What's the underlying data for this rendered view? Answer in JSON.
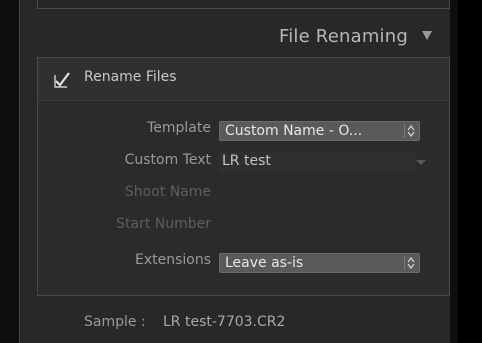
{
  "panel": {
    "title": "File Renaming",
    "collapse_icon": "triangle-down-icon"
  },
  "rename": {
    "checked": true,
    "label": "Rename Files"
  },
  "template": {
    "label": "Template",
    "value": "Custom Name - O..."
  },
  "custom_text": {
    "label": "Custom Text",
    "value": "LR test"
  },
  "shoot_name": {
    "label": "Shoot Name"
  },
  "start_number": {
    "label": "Start Number"
  },
  "extensions": {
    "label": "Extensions",
    "value": "Leave as-is"
  },
  "sample": {
    "label": "Sample :",
    "value": "LR test-7703.CR2"
  },
  "colors": {
    "panel_bg": "#282828",
    "select_bg": "#5a5a5a",
    "text": "#c8c8c8",
    "label": "#9a9a9a",
    "disabled_label": "#5f5f5f"
  }
}
